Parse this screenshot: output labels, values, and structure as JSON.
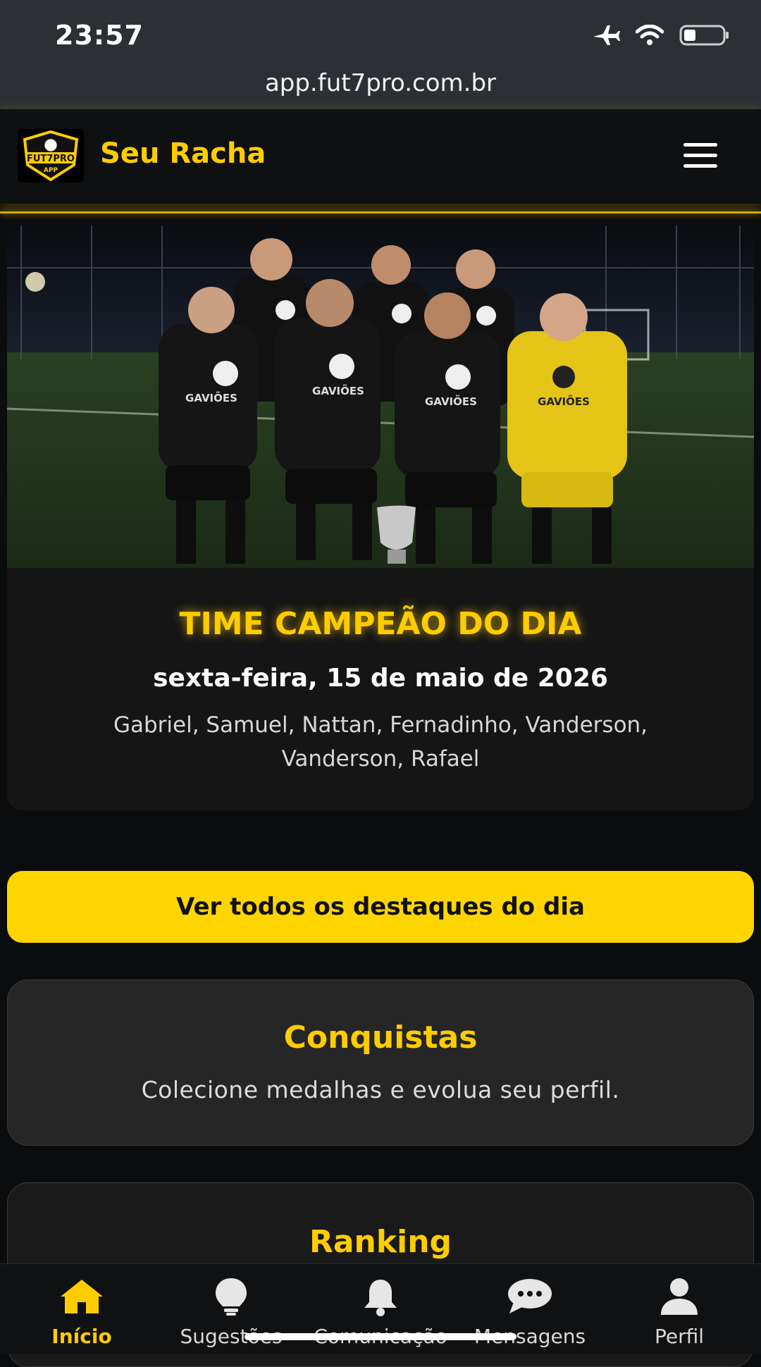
{
  "status_bar": {
    "time": "23:57"
  },
  "browser": {
    "url": "app.fut7pro.com.br"
  },
  "header": {
    "logo_text": "FUT7PRO",
    "logo_sub": "APP",
    "brand": "Seu Racha"
  },
  "champion": {
    "jersey_text": "GAVIÕES",
    "title": "TIME CAMPEÃO DO DIA",
    "date": "sexta-feira, 15 de maio de 2026",
    "players": "Gabriel, Samuel, Nattan, Fernadinho, Vanderson, Vanderson, Rafael"
  },
  "cta": {
    "label": "Ver todos os destaques do dia"
  },
  "sections": [
    {
      "title": "Conquistas",
      "description": "Colecione medalhas e evolua seu perfil."
    },
    {
      "title": "Ranking"
    }
  ],
  "bottom_nav": [
    {
      "label": "Início",
      "icon": "home-icon",
      "active": true
    },
    {
      "label": "Sugestões",
      "icon": "lightbulb-icon",
      "active": false
    },
    {
      "label": "Comunicação",
      "icon": "bell-icon",
      "active": false
    },
    {
      "label": "Mensagens",
      "icon": "chat-icon",
      "active": false
    },
    {
      "label": "Perfil",
      "icon": "user-icon",
      "active": false
    }
  ],
  "colors": {
    "accent": "#ffcc00",
    "background": "#0b0c0d",
    "card": "#262627"
  }
}
